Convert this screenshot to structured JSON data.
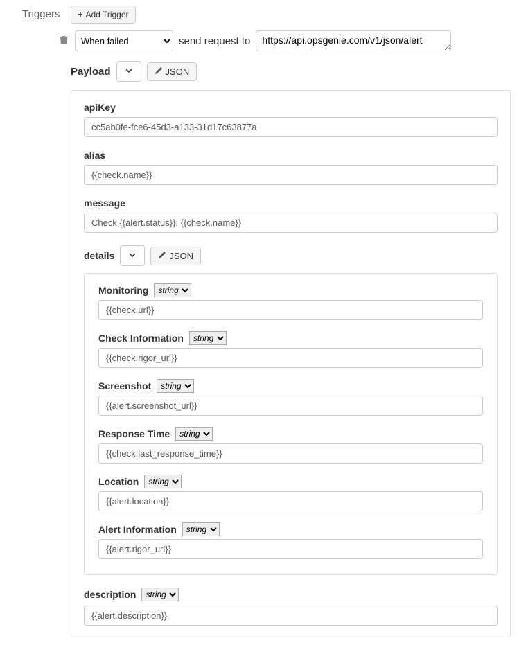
{
  "triggers": {
    "label": "Triggers",
    "add_button": "Add Trigger",
    "condition_selected": "When failed",
    "send_request_text": "send request to",
    "url": "https://api.opsgenie.com/v1/json/alert"
  },
  "payload": {
    "title": "Payload",
    "json_button": "JSON",
    "apiKey": {
      "label": "apiKey",
      "value": "cc5ab0fe-fce6-45d3-a133-31d17c63877a"
    },
    "alias": {
      "label": "alias",
      "value": "{{check.name}}"
    },
    "message": {
      "label": "message",
      "value": "Check {{alert.status}}: {{check.name}}"
    },
    "details": {
      "title": "details",
      "json_button": "JSON",
      "fields": [
        {
          "label": "Monitoring",
          "type": "string",
          "value": "{{check.url}}"
        },
        {
          "label": "Check Information",
          "type": "string",
          "value": "{{check.rigor_url}}"
        },
        {
          "label": "Screenshot",
          "type": "string",
          "value": "{{alert.screenshot_url}}"
        },
        {
          "label": "Response Time",
          "type": "string",
          "value": "{{check.last_response_time}}"
        },
        {
          "label": "Location",
          "type": "string",
          "value": "{{alert.location}}"
        },
        {
          "label": "Alert Information",
          "type": "string",
          "value": "{{alert.rigor_url}}"
        }
      ]
    },
    "description": {
      "label": "description",
      "type": "string",
      "value": "{{alert.description}}"
    }
  },
  "type_options": [
    "string"
  ]
}
